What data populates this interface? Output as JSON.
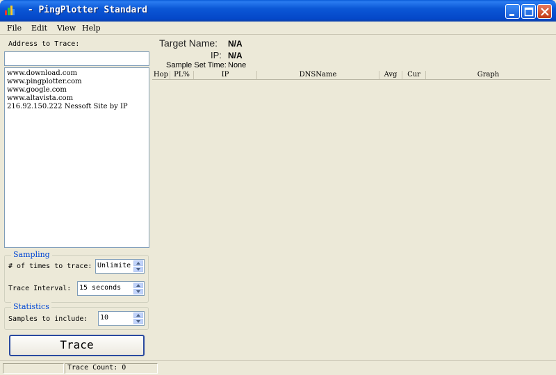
{
  "window": {
    "title": " - PingPlotter Standard"
  },
  "menu": {
    "items": [
      {
        "label": "File"
      },
      {
        "label": "Edit"
      },
      {
        "label": "View"
      },
      {
        "label": "Help"
      }
    ]
  },
  "left": {
    "address_label": "Address to Trace:",
    "address_value": "",
    "address_list": [
      "www.download.com",
      "www.pingplotter.com",
      "www.google.com",
      "www.altavista.com",
      "216.92.150.222 Nessoft Site by IP"
    ],
    "sampling": {
      "title": "Sampling",
      "times_label": "# of times to trace:",
      "times_value": "Unlimite",
      "interval_label": "Trace Interval:",
      "interval_value": "15 seconds"
    },
    "statistics": {
      "title": "Statistics",
      "samples_label": "Samples to include:",
      "samples_value": "10"
    },
    "trace_button": "Trace"
  },
  "right": {
    "target_name_label": "Target Name:",
    "target_name_value": "N/A",
    "ip_label": "IP:",
    "ip_value": "N/A",
    "sample_set_time_label": "Sample Set Time:",
    "sample_set_time_value": "None",
    "columns": [
      "Hop",
      "PL%",
      "IP",
      "DNSName",
      "Avg",
      "Cur",
      "Graph"
    ]
  },
  "status": {
    "trace_count": "Trace Count: 0"
  },
  "colors": {
    "titlebar": "#0b57d6",
    "window_bg": "#ece9d8",
    "group_title": "#0046d5"
  }
}
